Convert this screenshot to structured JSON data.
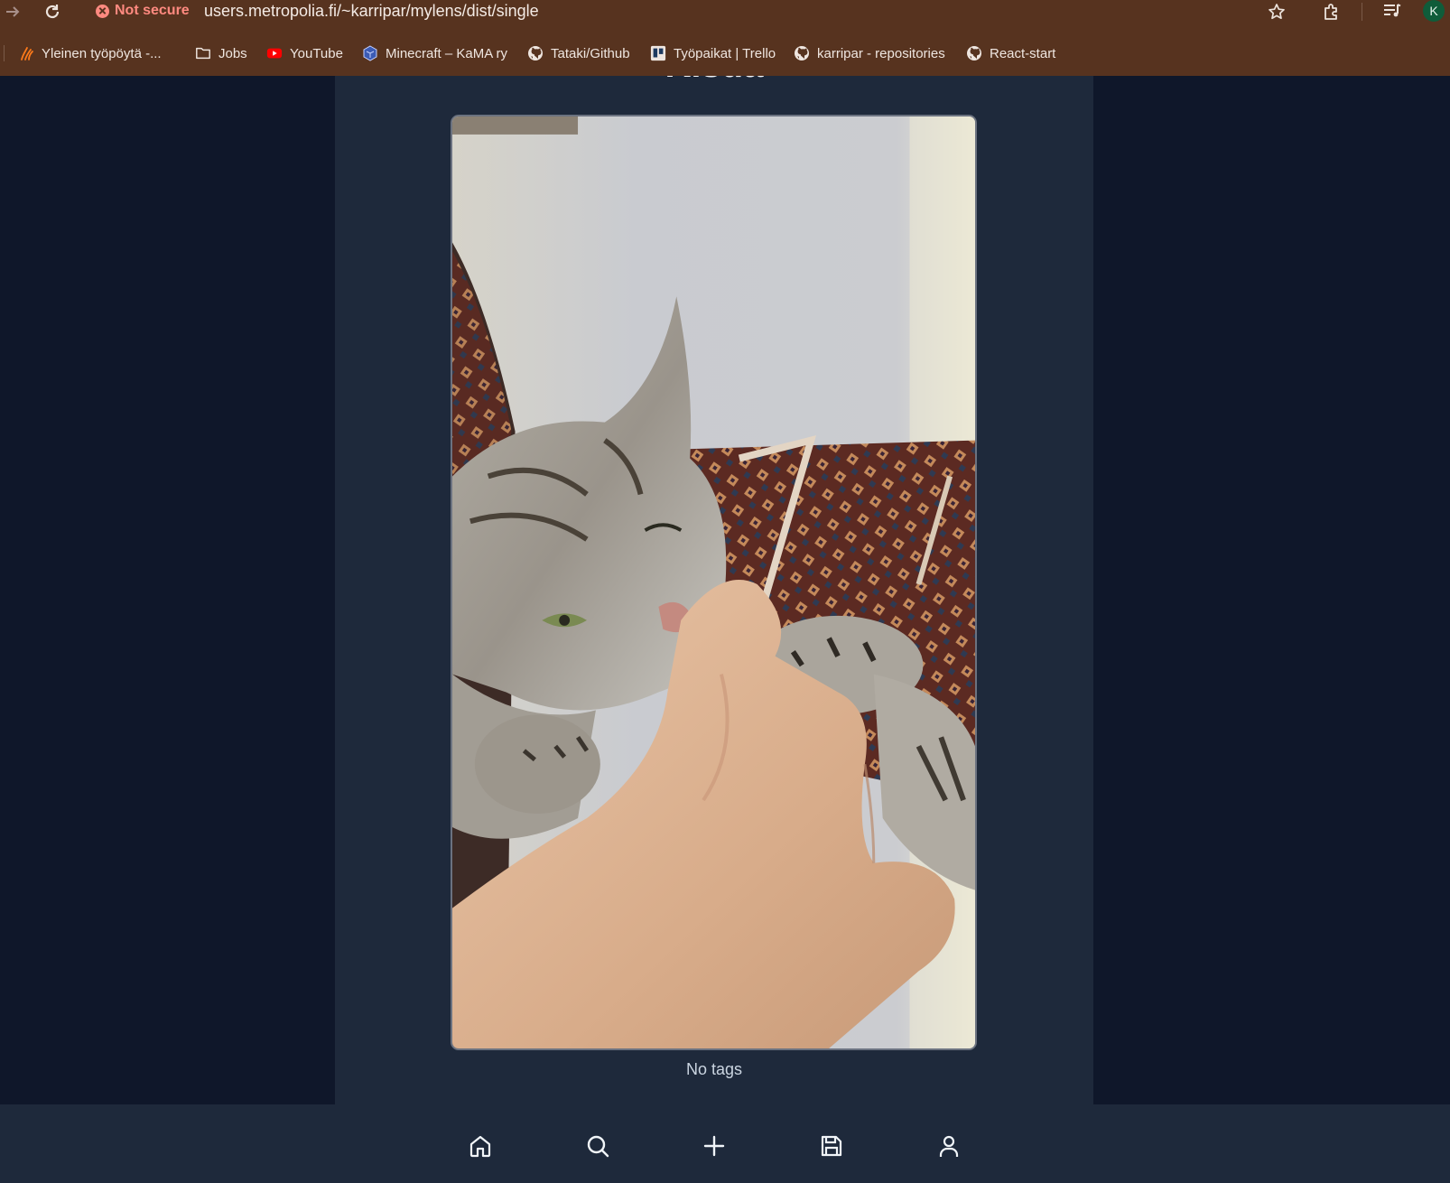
{
  "browser": {
    "security_label": "Not secure",
    "url": "users.metropolia.fi/~karripar/mylens/dist/single",
    "profile_initial": "K",
    "bookmarks": [
      {
        "label": "Yleinen työpöytä -...",
        "icon": "flame-icon"
      },
      {
        "label": "Jobs",
        "icon": "folder-icon"
      },
      {
        "label": "YouTube",
        "icon": "youtube-icon"
      },
      {
        "label": "Minecraft – KaMA ry",
        "icon": "shield-icon"
      },
      {
        "label": "Tataki/Github",
        "icon": "github-icon"
      },
      {
        "label": "Työpaikat | Trello",
        "icon": "trello-icon"
      },
      {
        "label": "karripar - repositories",
        "icon": "github-icon"
      },
      {
        "label": "React-start",
        "icon": "github-icon"
      }
    ]
  },
  "page": {
    "title": "Kisua",
    "tags_text": "No tags",
    "background_color": "#0f172a",
    "panel_color": "#1e293b"
  },
  "bottom_nav": [
    {
      "icon": "home-icon"
    },
    {
      "icon": "search-icon"
    },
    {
      "icon": "plus-icon"
    },
    {
      "icon": "save-icon"
    },
    {
      "icon": "user-icon"
    }
  ]
}
